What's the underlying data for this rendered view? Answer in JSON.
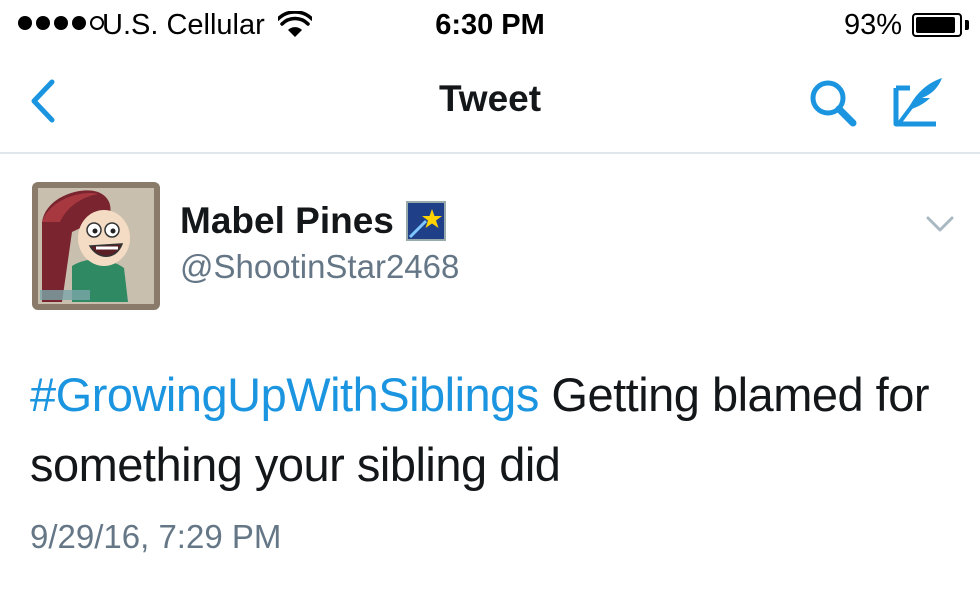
{
  "status_bar": {
    "signal_bars": [
      true,
      true,
      true,
      true,
      false
    ],
    "carrier": "U.S. Cellular",
    "time": "6:30 PM",
    "battery_percent": "93%",
    "battery_level": 0.93,
    "wifi_icon": "wifi-icon"
  },
  "nav": {
    "title": "Tweet",
    "back_icon": "chevron-left-icon",
    "search_icon": "search-icon",
    "compose_icon": "compose-tweet-icon",
    "accent_color": "#1b95e0"
  },
  "tweet": {
    "author": {
      "name": "Mabel Pines",
      "handle": "@ShootinStar2468",
      "badge_icon": "shooting-star-icon"
    },
    "hashtag": "#GrowingUpWithSiblings",
    "text": " Getting blamed for something your sibling did",
    "timestamp": "9/29/16, 7:29 PM",
    "menu_icon": "chevron-down-icon"
  }
}
